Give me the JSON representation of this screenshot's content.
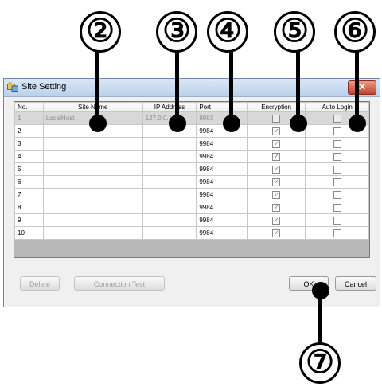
{
  "callouts": [
    "②",
    "③",
    "④",
    "⑤",
    "⑥",
    "⑦"
  ],
  "window": {
    "title": "Site Setting",
    "close_label": "✕"
  },
  "table": {
    "headers": [
      "No.",
      "Site Name",
      "IP Address",
      "Port",
      "Encryption",
      "Auto Login"
    ],
    "rows": [
      {
        "no": "1",
        "name": "LocalHost",
        "ip": "127.0.0.1",
        "port": "9983",
        "encryption": false,
        "auto_login": false
      },
      {
        "no": "2",
        "name": "",
        "ip": "",
        "port": "9984",
        "encryption": true,
        "auto_login": false
      },
      {
        "no": "3",
        "name": "",
        "ip": "",
        "port": "9984",
        "encryption": true,
        "auto_login": false
      },
      {
        "no": "4",
        "name": "",
        "ip": "",
        "port": "9984",
        "encryption": true,
        "auto_login": false
      },
      {
        "no": "5",
        "name": "",
        "ip": "",
        "port": "9984",
        "encryption": true,
        "auto_login": false
      },
      {
        "no": "6",
        "name": "",
        "ip": "",
        "port": "9984",
        "encryption": true,
        "auto_login": false
      },
      {
        "no": "7",
        "name": "",
        "ip": "",
        "port": "9984",
        "encryption": true,
        "auto_login": false
      },
      {
        "no": "8",
        "name": "",
        "ip": "",
        "port": "9984",
        "encryption": true,
        "auto_login": false
      },
      {
        "no": "9",
        "name": "",
        "ip": "",
        "port": "9984",
        "encryption": true,
        "auto_login": false
      },
      {
        "no": "10",
        "name": "",
        "ip": "",
        "port": "9984",
        "encryption": true,
        "auto_login": false
      }
    ]
  },
  "buttons": {
    "delete": "Delete",
    "connection_test": "Connection Test",
    "ok": "OK",
    "cancel": "Cancel"
  }
}
